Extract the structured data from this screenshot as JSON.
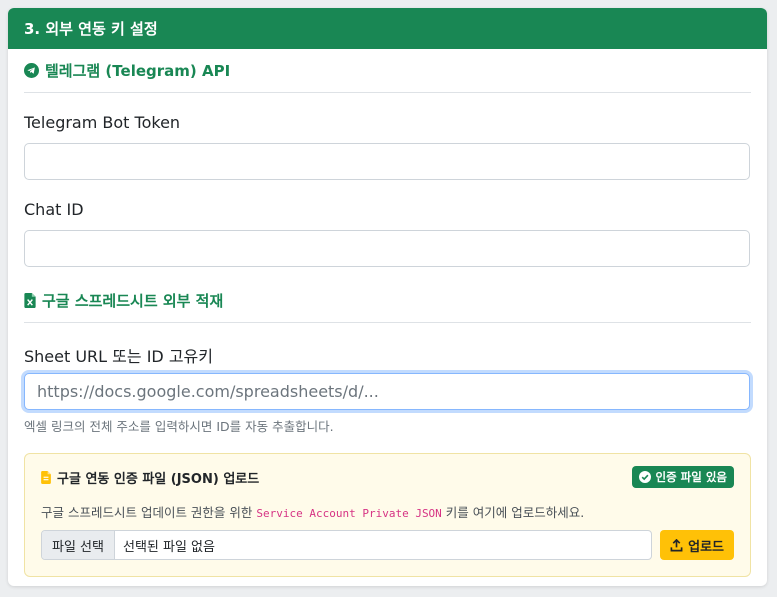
{
  "header": {
    "title": "3. 외부 연동 키 설정"
  },
  "telegram": {
    "section_title": "텔레그램 (Telegram) API",
    "bot_token_label": "Telegram Bot Token",
    "bot_token_value": "",
    "chat_id_label": "Chat ID",
    "chat_id_value": ""
  },
  "sheets": {
    "section_title": "구글 스프레드시트 외부 적재",
    "url_label": "Sheet URL 또는 ID 고유키",
    "url_placeholder": "https://docs.google.com/spreadsheets/d/...",
    "url_help": "엑셀 링크의 전체 주소를 입력하시면 ID를 자동 추출합니다."
  },
  "upload": {
    "title": "구글 연동 인증 파일 (JSON) 업로드",
    "badge": "인증 파일 있음",
    "desc_prefix": "구글 스프레드시트 업데이트 권한을 위한 ",
    "desc_code": "Service Account Private JSON",
    "desc_suffix": " 키를 여기에 업로드하세요.",
    "file_button": "파일 선택",
    "file_name": "선택된 파일 없음",
    "upload_button": "업로드"
  },
  "colors": {
    "primary_green": "#198754",
    "warning_yellow": "#ffc107",
    "code_pink": "#d63384"
  },
  "icons": [
    "telegram-icon",
    "spreadsheet-icon",
    "file-json-icon",
    "check-circle-icon",
    "upload-icon"
  ]
}
